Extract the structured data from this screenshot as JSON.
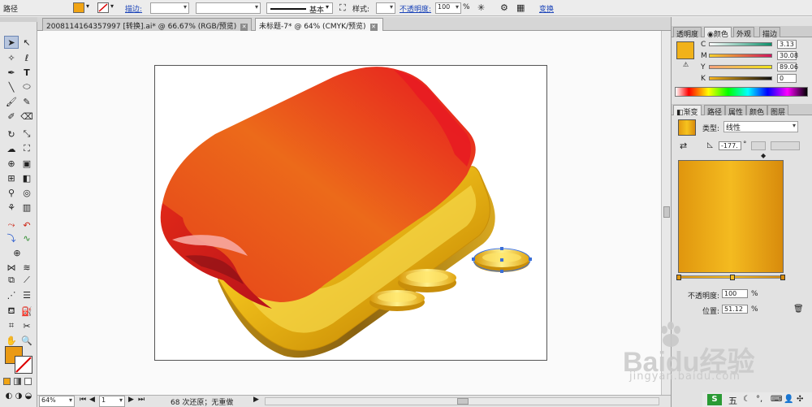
{
  "control_bar": {
    "object_type": "路径",
    "stroke_label": "描边:",
    "brush_label": "基本",
    "style_label": "样式:",
    "opacity_label": "不透明度:",
    "opacity_value": "100",
    "opacity_unit": "%",
    "transform_link": "变换"
  },
  "doc_tabs": [
    {
      "label": "2008114164357997 [转换].ai* @ 66.67% (RGB/预览)",
      "active": false
    },
    {
      "label": "未标题-7* @ 64% (CMYK/预览)",
      "active": true
    }
  ],
  "status_bar": {
    "zoom": "64%",
    "page": "1",
    "message": "68 次还原；无重做"
  },
  "color_panel": {
    "tabs": [
      "透明度",
      "颜色",
      "外观",
      "描边"
    ],
    "active_tab": "颜色",
    "channels": [
      {
        "name": "C",
        "value": "3.13"
      },
      {
        "name": "M",
        "value": "30.08"
      },
      {
        "name": "Y",
        "value": "89.06"
      },
      {
        "name": "K",
        "value": "0"
      }
    ],
    "colors": {
      "fill": "#f1b21a",
      "c": "#0b8f6a",
      "m": "#d1155d",
      "y": "#f0e21a",
      "k": "#111111"
    }
  },
  "gradient_panel": {
    "tabs": [
      "渐变",
      "路径",
      "属性",
      "颜色",
      "图层"
    ],
    "active_tab": "渐变",
    "type_label": "类型:",
    "type_value": "线性",
    "angle": "-177.",
    "angle_unit": "°",
    "opacity_label": "不透明度:",
    "opacity_value": "100",
    "location_label": "位置:",
    "location_value": "51.12",
    "unit": "%"
  },
  "watermark": {
    "logo": "Baidu经验",
    "url": "jingyan.baidu.com"
  },
  "taskbar": {
    "ime": "五"
  }
}
